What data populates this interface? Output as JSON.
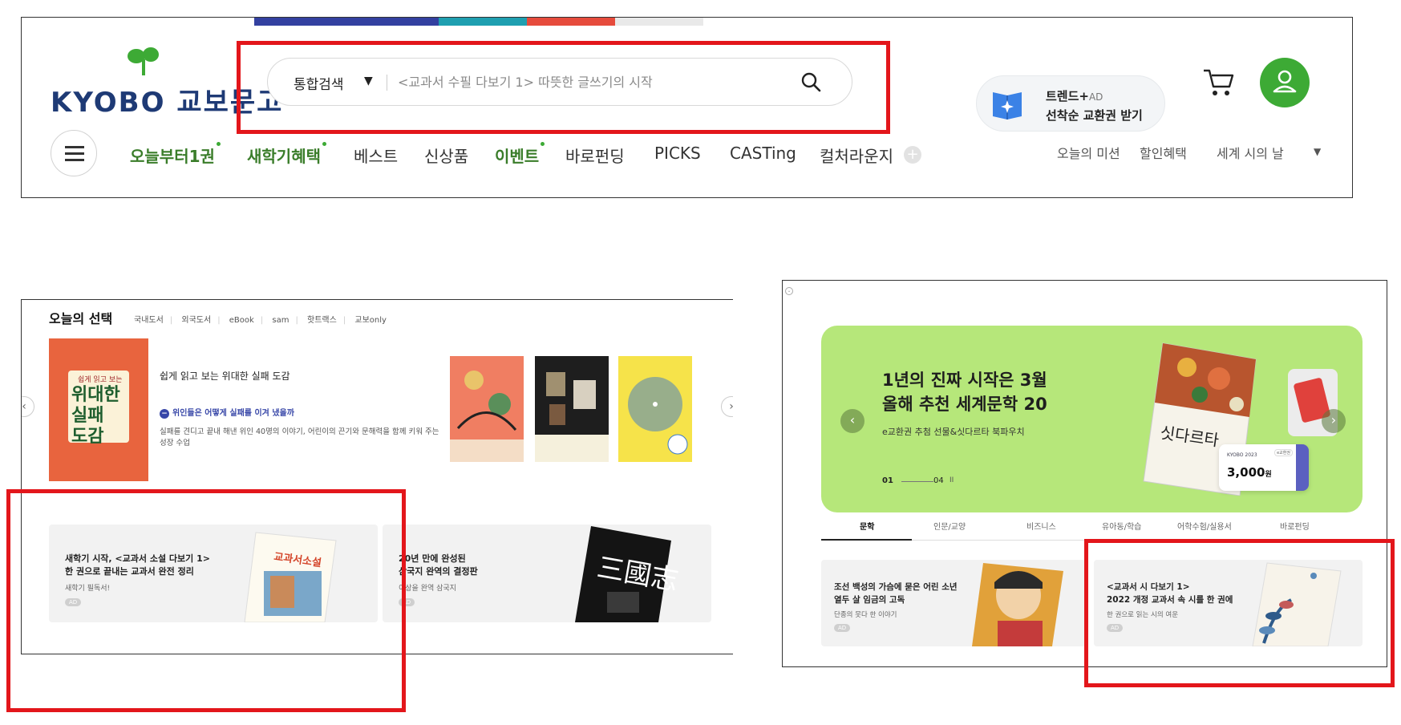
{
  "header": {
    "logo_text": "KYOBO 교보문고",
    "search": {
      "category": "통합검색",
      "placeholder": "<교과서 수필 다보기 1> 따뜻한 글쓰기의 시작"
    },
    "ad": {
      "line1": "트렌드+",
      "line1_ad": "AD",
      "line2": "선착순 교환권 받기"
    },
    "nav": [
      {
        "label": "오늘부터1권",
        "highlight": true
      },
      {
        "label": "새학기혜택",
        "highlight": true
      },
      {
        "label": "베스트",
        "highlight": false
      },
      {
        "label": "신상품",
        "highlight": false
      },
      {
        "label": "이벤트",
        "highlight": true
      },
      {
        "label": "바로펀딩",
        "highlight": false
      },
      {
        "label": "PICKS",
        "highlight": false
      },
      {
        "label": "CASTing",
        "highlight": false
      },
      {
        "label": "컬처라운지",
        "highlight": false
      }
    ],
    "nav_plus": "+",
    "subnav": [
      "오늘의 미션",
      "할인혜택",
      "세계 시의 날"
    ],
    "colors": {
      "brand_green": "#3daa35",
      "logo_navy": "#1e3a75",
      "highlight_red": "#e3161b"
    }
  },
  "left_panel": {
    "title": "오늘의 선택",
    "tabs": [
      "국내도서",
      "외국도서",
      "eBook",
      "sam",
      "핫트랙스",
      "교보only"
    ],
    "feature": {
      "cover_top": "쉽게 읽고 보는",
      "cover_title_1": "위대한",
      "cover_title_2": "실패",
      "cover_title_3": "도감",
      "title": "쉽게 읽고 보는 위대한 실패 도감",
      "bullet": "위인들은 어떻게 실패를 이겨 냈을까",
      "desc": "실패를 견디고 끝내 해낸 위인 40명의 이야기, 어린이의 끈기와 문해력을 함께 키워 주는 성장 수업"
    },
    "prev": "‹",
    "next": "›",
    "cards": [
      {
        "t1": "새학기 시작, <교과서 소설 다보기 1>",
        "t2": "한 권으로 끝내는 교과서 완전 정리",
        "t3": "새학기 필독서!",
        "ad": "AD"
      },
      {
        "t1": "20년 만에 완성된",
        "t2": "삼국지 완역의 결정판",
        "t3": "이상을 완역 삼국지",
        "ad": "AD"
      }
    ]
  },
  "right_panel": {
    "banner": {
      "h1": "1년의 진짜 시작은 3월",
      "h2": "올해 추천 세계문학 20",
      "sub": "e교환권 추첨 선물&싯다르타 북파우치",
      "page_current": "01",
      "page_total": "04",
      "pause": "II",
      "prev": "‹",
      "next": "›",
      "book_title": "싯다르타",
      "price_brand": "KYOBO 2023",
      "price_tag": "e교환권",
      "price": "3,000",
      "price_unit": "원"
    },
    "tabs": [
      "문학",
      "인문/교양",
      "비즈니스",
      "유아동/학습",
      "어학수험/실용서",
      "바로펀딩"
    ],
    "active_tab": 0,
    "cards": [
      {
        "t1": "조선 백성의 가슴에 묻은 어린 소년",
        "t2": "열두 살 임금의 고독",
        "t3": "단종의 못다 한 이야기",
        "ad": "AD"
      },
      {
        "t1": "<교과서 시 다보기 1>",
        "t2": "2022 개정 교과서 속 시를 한 권에",
        "t3": "한 권으로 읽는 시의 여운",
        "ad": "AD"
      }
    ]
  }
}
